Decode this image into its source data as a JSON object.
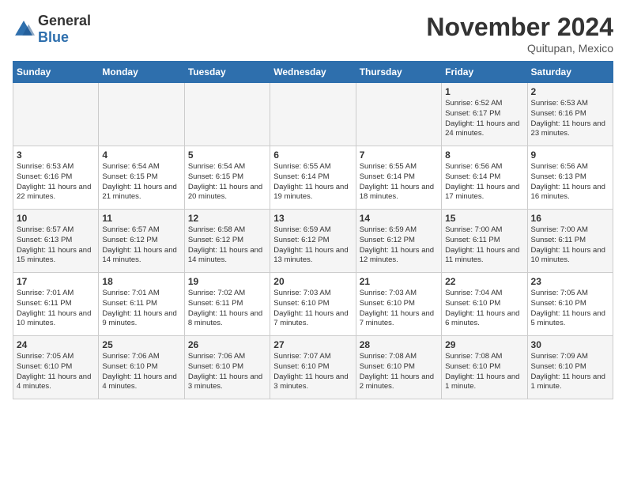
{
  "logo": {
    "general": "General",
    "blue": "Blue"
  },
  "header": {
    "month": "November 2024",
    "location": "Quitupan, Mexico"
  },
  "weekdays": [
    "Sunday",
    "Monday",
    "Tuesday",
    "Wednesday",
    "Thursday",
    "Friday",
    "Saturday"
  ],
  "weeks": [
    [
      {
        "day": "",
        "sunrise": "",
        "sunset": "",
        "daylight": ""
      },
      {
        "day": "",
        "sunrise": "",
        "sunset": "",
        "daylight": ""
      },
      {
        "day": "",
        "sunrise": "",
        "sunset": "",
        "daylight": ""
      },
      {
        "day": "",
        "sunrise": "",
        "sunset": "",
        "daylight": ""
      },
      {
        "day": "",
        "sunrise": "",
        "sunset": "",
        "daylight": ""
      },
      {
        "day": "1",
        "sunrise": "Sunrise: 6:52 AM",
        "sunset": "Sunset: 6:17 PM",
        "daylight": "Daylight: 11 hours and 24 minutes."
      },
      {
        "day": "2",
        "sunrise": "Sunrise: 6:53 AM",
        "sunset": "Sunset: 6:16 PM",
        "daylight": "Daylight: 11 hours and 23 minutes."
      }
    ],
    [
      {
        "day": "3",
        "sunrise": "Sunrise: 6:53 AM",
        "sunset": "Sunset: 6:16 PM",
        "daylight": "Daylight: 11 hours and 22 minutes."
      },
      {
        "day": "4",
        "sunrise": "Sunrise: 6:54 AM",
        "sunset": "Sunset: 6:15 PM",
        "daylight": "Daylight: 11 hours and 21 minutes."
      },
      {
        "day": "5",
        "sunrise": "Sunrise: 6:54 AM",
        "sunset": "Sunset: 6:15 PM",
        "daylight": "Daylight: 11 hours and 20 minutes."
      },
      {
        "day": "6",
        "sunrise": "Sunrise: 6:55 AM",
        "sunset": "Sunset: 6:14 PM",
        "daylight": "Daylight: 11 hours and 19 minutes."
      },
      {
        "day": "7",
        "sunrise": "Sunrise: 6:55 AM",
        "sunset": "Sunset: 6:14 PM",
        "daylight": "Daylight: 11 hours and 18 minutes."
      },
      {
        "day": "8",
        "sunrise": "Sunrise: 6:56 AM",
        "sunset": "Sunset: 6:14 PM",
        "daylight": "Daylight: 11 hours and 17 minutes."
      },
      {
        "day": "9",
        "sunrise": "Sunrise: 6:56 AM",
        "sunset": "Sunset: 6:13 PM",
        "daylight": "Daylight: 11 hours and 16 minutes."
      }
    ],
    [
      {
        "day": "10",
        "sunrise": "Sunrise: 6:57 AM",
        "sunset": "Sunset: 6:13 PM",
        "daylight": "Daylight: 11 hours and 15 minutes."
      },
      {
        "day": "11",
        "sunrise": "Sunrise: 6:57 AM",
        "sunset": "Sunset: 6:12 PM",
        "daylight": "Daylight: 11 hours and 14 minutes."
      },
      {
        "day": "12",
        "sunrise": "Sunrise: 6:58 AM",
        "sunset": "Sunset: 6:12 PM",
        "daylight": "Daylight: 11 hours and 14 minutes."
      },
      {
        "day": "13",
        "sunrise": "Sunrise: 6:59 AM",
        "sunset": "Sunset: 6:12 PM",
        "daylight": "Daylight: 11 hours and 13 minutes."
      },
      {
        "day": "14",
        "sunrise": "Sunrise: 6:59 AM",
        "sunset": "Sunset: 6:12 PM",
        "daylight": "Daylight: 11 hours and 12 minutes."
      },
      {
        "day": "15",
        "sunrise": "Sunrise: 7:00 AM",
        "sunset": "Sunset: 6:11 PM",
        "daylight": "Daylight: 11 hours and 11 minutes."
      },
      {
        "day": "16",
        "sunrise": "Sunrise: 7:00 AM",
        "sunset": "Sunset: 6:11 PM",
        "daylight": "Daylight: 11 hours and 10 minutes."
      }
    ],
    [
      {
        "day": "17",
        "sunrise": "Sunrise: 7:01 AM",
        "sunset": "Sunset: 6:11 PM",
        "daylight": "Daylight: 11 hours and 10 minutes."
      },
      {
        "day": "18",
        "sunrise": "Sunrise: 7:01 AM",
        "sunset": "Sunset: 6:11 PM",
        "daylight": "Daylight: 11 hours and 9 minutes."
      },
      {
        "day": "19",
        "sunrise": "Sunrise: 7:02 AM",
        "sunset": "Sunset: 6:11 PM",
        "daylight": "Daylight: 11 hours and 8 minutes."
      },
      {
        "day": "20",
        "sunrise": "Sunrise: 7:03 AM",
        "sunset": "Sunset: 6:10 PM",
        "daylight": "Daylight: 11 hours and 7 minutes."
      },
      {
        "day": "21",
        "sunrise": "Sunrise: 7:03 AM",
        "sunset": "Sunset: 6:10 PM",
        "daylight": "Daylight: 11 hours and 7 minutes."
      },
      {
        "day": "22",
        "sunrise": "Sunrise: 7:04 AM",
        "sunset": "Sunset: 6:10 PM",
        "daylight": "Daylight: 11 hours and 6 minutes."
      },
      {
        "day": "23",
        "sunrise": "Sunrise: 7:05 AM",
        "sunset": "Sunset: 6:10 PM",
        "daylight": "Daylight: 11 hours and 5 minutes."
      }
    ],
    [
      {
        "day": "24",
        "sunrise": "Sunrise: 7:05 AM",
        "sunset": "Sunset: 6:10 PM",
        "daylight": "Daylight: 11 hours and 4 minutes."
      },
      {
        "day": "25",
        "sunrise": "Sunrise: 7:06 AM",
        "sunset": "Sunset: 6:10 PM",
        "daylight": "Daylight: 11 hours and 4 minutes."
      },
      {
        "day": "26",
        "sunrise": "Sunrise: 7:06 AM",
        "sunset": "Sunset: 6:10 PM",
        "daylight": "Daylight: 11 hours and 3 minutes."
      },
      {
        "day": "27",
        "sunrise": "Sunrise: 7:07 AM",
        "sunset": "Sunset: 6:10 PM",
        "daylight": "Daylight: 11 hours and 3 minutes."
      },
      {
        "day": "28",
        "sunrise": "Sunrise: 7:08 AM",
        "sunset": "Sunset: 6:10 PM",
        "daylight": "Daylight: 11 hours and 2 minutes."
      },
      {
        "day": "29",
        "sunrise": "Sunrise: 7:08 AM",
        "sunset": "Sunset: 6:10 PM",
        "daylight": "Daylight: 11 hours and 1 minute."
      },
      {
        "day": "30",
        "sunrise": "Sunrise: 7:09 AM",
        "sunset": "Sunset: 6:10 PM",
        "daylight": "Daylight: 11 hours and 1 minute."
      }
    ]
  ]
}
